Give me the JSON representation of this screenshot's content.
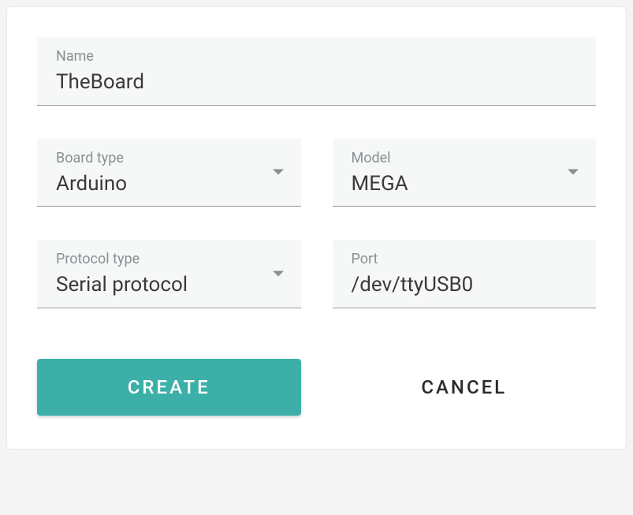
{
  "fields": {
    "name": {
      "label": "Name",
      "value": "TheBoard"
    },
    "boardType": {
      "label": "Board type",
      "value": "Arduino"
    },
    "model": {
      "label": "Model",
      "value": "MEGA"
    },
    "protocolType": {
      "label": "Protocol type",
      "value": "Serial protocol"
    },
    "port": {
      "label": "Port",
      "value": "/dev/ttyUSB0"
    }
  },
  "actions": {
    "create": "CREATE",
    "cancel": "CANCEL"
  },
  "colors": {
    "primary": "#3cb0a8"
  }
}
